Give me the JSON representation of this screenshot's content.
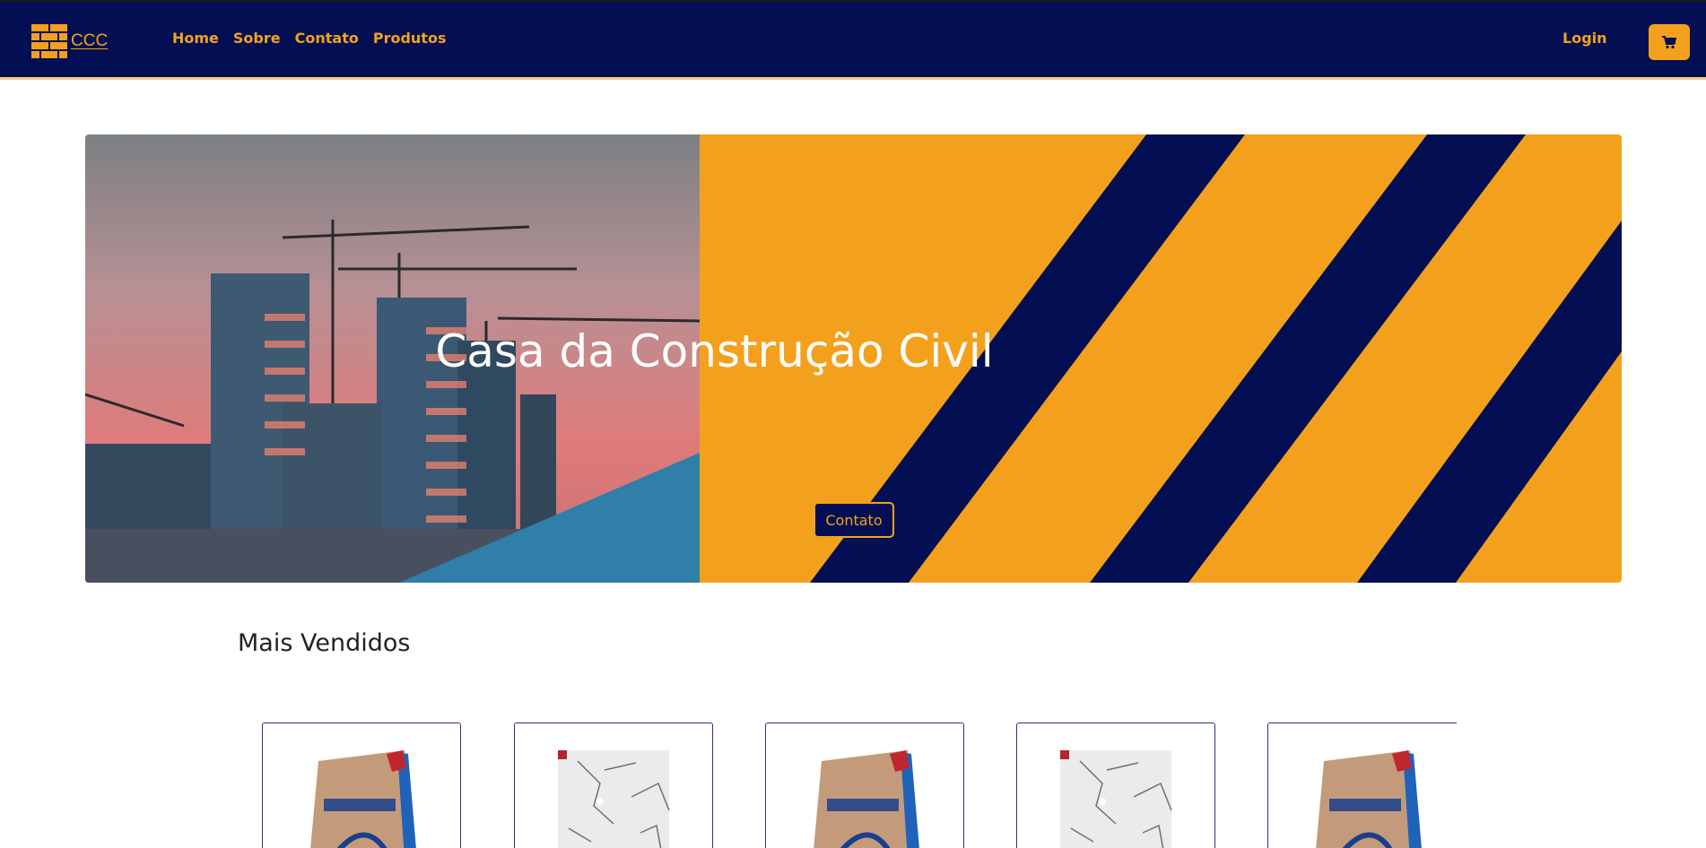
{
  "navbar": {
    "brand": "CCC",
    "links": [
      "Home",
      "Sobre",
      "Contato",
      "Produtos"
    ],
    "login": "Login",
    "cart_icon": "shopping-cart-icon"
  },
  "hero": {
    "title": "Casa da Construção Civil",
    "cta": "Contato"
  },
  "best_sellers": {
    "title": "Mais Vendidos",
    "products": [
      {
        "image": "cement-bag"
      },
      {
        "image": "marble-tile"
      },
      {
        "image": "cement-bag"
      },
      {
        "image": "marble-tile"
      },
      {
        "image": "cement-bag"
      }
    ]
  },
  "colors": {
    "navy": "#030f52",
    "orange": "#f3a11d"
  }
}
